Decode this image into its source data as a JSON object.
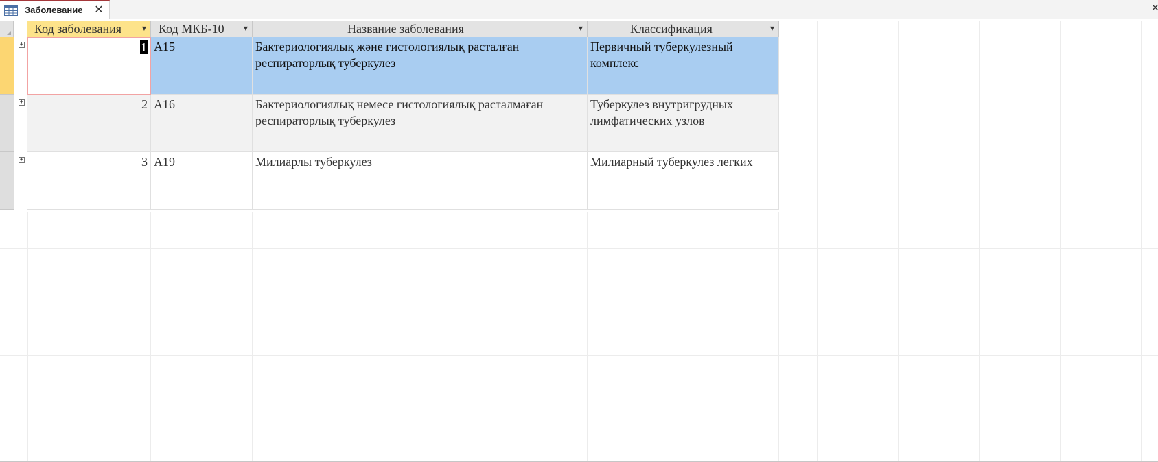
{
  "tab": {
    "title": "Заболевание",
    "icon": "table-icon",
    "close_icon": "close-icon"
  },
  "window": {
    "close_glyph": "✕"
  },
  "columns": [
    {
      "label": "Код заболевания",
      "filter_icon": "dropdown-arrow-icon"
    },
    {
      "label": "Код МКБ-10",
      "filter_icon": "dropdown-arrow-icon"
    },
    {
      "label": "Название заболевания",
      "filter_icon": "dropdown-arrow-icon"
    },
    {
      "label": "Классификация",
      "filter_icon": "dropdown-arrow-icon"
    }
  ],
  "rows": [
    {
      "id": "1",
      "icd": "A15",
      "name": "Бактериологиялық және гистологиялық расталған респираторлық туберкулез",
      "classification": "Первичный туберкулезный комплекс"
    },
    {
      "id": "2",
      "icd": "A16",
      "name": "Бактериологиялық немесе гистологиялық расталмаған респираторлық туберкулез",
      "classification": "Туберкулез внутригрудных лимфатических узлов"
    },
    {
      "id": "3",
      "icd": "A19",
      "name": "Милиарлы туберкулез",
      "classification": "Милиарный туберкулез легких"
    }
  ],
  "colors": {
    "selected_row": "#a9cdf1",
    "active_header": "#fde38a",
    "current_record_selector": "#fcd672",
    "tab_accent": "#a4373a"
  }
}
